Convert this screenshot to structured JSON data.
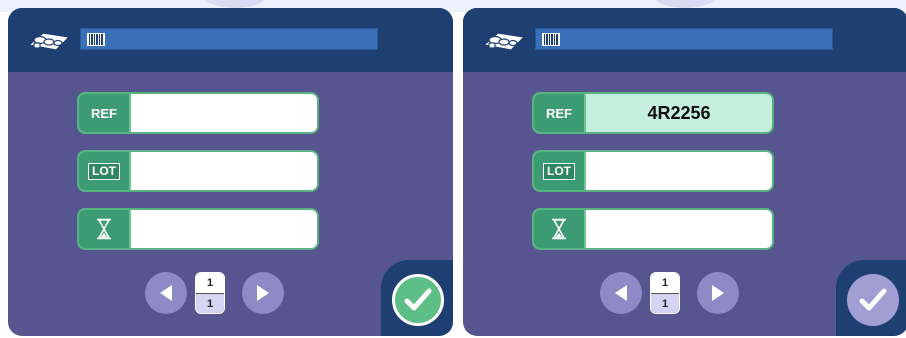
{
  "screens": [
    {
      "id": "left",
      "fields": [
        {
          "tag": "REF",
          "value": ""
        },
        {
          "tag": "LOT",
          "value": ""
        },
        {
          "tag": "expiry-hourglass",
          "value": ""
        }
      ],
      "pager": {
        "current": "1",
        "total": "1"
      },
      "confirm_state": "enabled"
    },
    {
      "id": "right",
      "fields": [
        {
          "tag": "REF",
          "value": "4R2256"
        },
        {
          "tag": "LOT",
          "value": ""
        },
        {
          "tag": "expiry-hourglass",
          "value": ""
        }
      ],
      "pager": {
        "current": "1",
        "total": "1"
      },
      "confirm_state": "disabled"
    }
  ],
  "icons": {
    "logo": "reagent-pack-icon",
    "barcode": "barcode-icon",
    "expiry": "hourglass-icon",
    "prev": "arrow-left-icon",
    "next": "arrow-right-icon",
    "confirm": "checkmark-icon"
  },
  "colors": {
    "header": "#1e3f72",
    "body": "#56558f",
    "accent_green": "#3d9b74",
    "field_filled": "#c6eede",
    "barcode_bar": "#3a70b7"
  }
}
